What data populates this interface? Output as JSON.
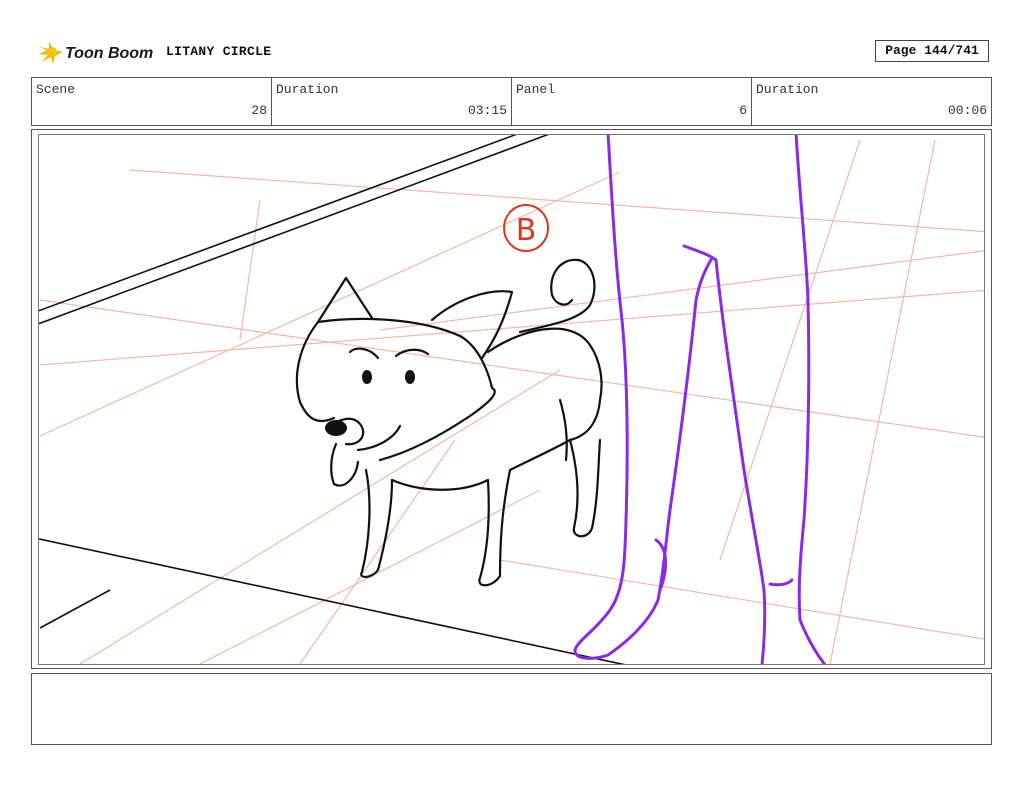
{
  "header": {
    "logo_text": "Toon Boom",
    "title": "LITANY CIRCLE",
    "page_label": "Page 144/741"
  },
  "info": {
    "scene_label": "Scene",
    "scene_value": "28",
    "scene_duration_label": "Duration",
    "scene_duration_value": "03:15",
    "panel_label": "Panel",
    "panel_value": "6",
    "panel_duration_label": "Duration",
    "panel_duration_value": "00:06"
  },
  "panel": {
    "marker_letter": "B",
    "colors": {
      "ink": "#111111",
      "legs": "#8a2be2",
      "marker": "#d9381e",
      "floor_grid": "#f2b8a8"
    }
  },
  "notes": {
    "text": ""
  }
}
